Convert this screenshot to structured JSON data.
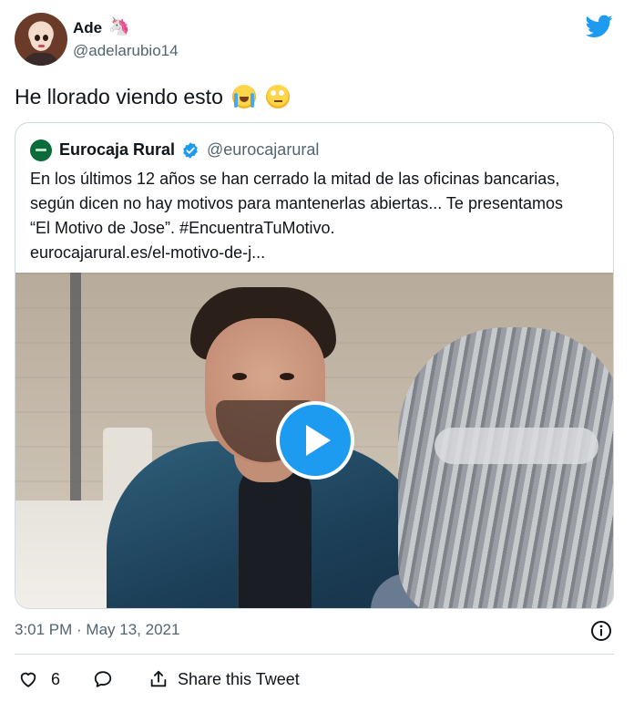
{
  "author": {
    "name": "Ade",
    "name_emoji": "🦄",
    "handle": "@adelarubio14"
  },
  "tweet": {
    "text": "He llorado viendo esto",
    "emojis": [
      "loudly-crying-face",
      "face-with-rolling-eyes"
    ]
  },
  "quoted": {
    "name": "Eurocaja Rural",
    "verified": true,
    "handle": "@eurocajarural",
    "lines": [
      "En los últimos 12 años se han cerrado la mitad de las oficinas bancarias,",
      "según dicen no hay motivos para mantenerlas abiertas... Te presentamos",
      "“El Motivo de Jose”. #EncuentraTuMotivo.",
      "eurocajarural.es/el-motivo-de-j..."
    ],
    "media": {
      "type": "video",
      "icon": "play-icon"
    }
  },
  "meta": {
    "timestamp": "3:01 PM · May 13, 2021"
  },
  "actions": {
    "likes": "6",
    "share_label": "Share this Tweet"
  },
  "colors": {
    "brand": "#1d9bf0",
    "text": "#0f1419",
    "secondary": "#536471",
    "border": "#cfd9de",
    "eurocaja_green": "#0b6b3a"
  }
}
